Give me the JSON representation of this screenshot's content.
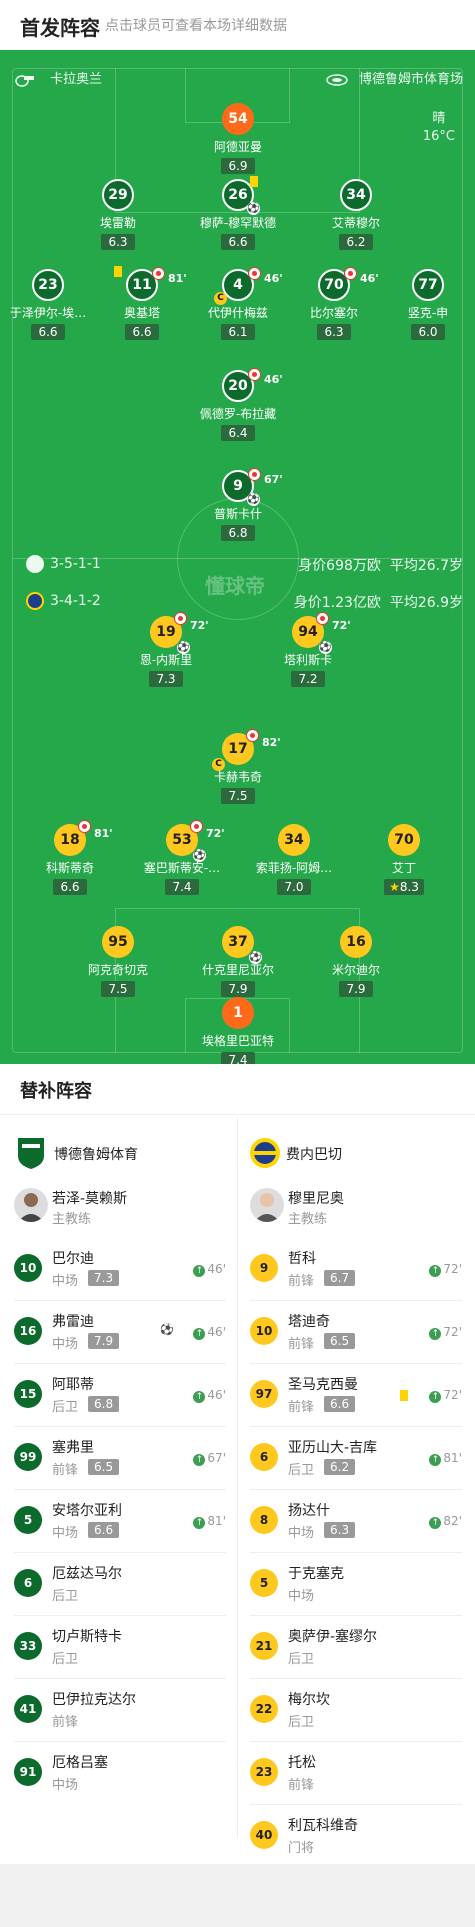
{
  "header": {
    "title": "首发阵容",
    "subtitle": "点击球员可查看本场详细数据"
  },
  "field": {
    "referee": "卡拉奥兰",
    "stadium": "博德鲁姆市体育场",
    "weather": "晴",
    "temp": "16°C",
    "brand": "懂球帝",
    "home": {
      "formation": "3-5-1-1",
      "value": "身价698万欧",
      "avg_age": "平均26.7岁"
    },
    "away": {
      "formation": "3-4-1-2",
      "value": "身价1.23亿欧",
      "avg_age": "平均26.9岁"
    },
    "players": [
      {
        "num": "54",
        "name": "阿德亚曼",
        "rating": "6.9",
        "side": "gk"
      },
      {
        "num": "29",
        "name": "埃雷勒",
        "rating": "6.3",
        "side": "h"
      },
      {
        "num": "26",
        "name": "穆萨-穆罕默德",
        "rating": "6.6",
        "side": "h"
      },
      {
        "num": "34",
        "name": "艾蒂穆尔",
        "rating": "6.2",
        "side": "h"
      },
      {
        "num": "23",
        "name": "于泽伊尔-埃…",
        "rating": "6.6",
        "side": "h"
      },
      {
        "num": "11",
        "name": "奥基塔",
        "rating": "6.6",
        "side": "h",
        "sub": "81'"
      },
      {
        "num": "4",
        "name": "代伊什梅兹",
        "rating": "6.1",
        "side": "h",
        "sub": "46'"
      },
      {
        "num": "70",
        "name": "比尔塞尔",
        "rating": "6.3",
        "side": "h",
        "sub": "46'"
      },
      {
        "num": "77",
        "name": "竖克-申",
        "rating": "6.0",
        "side": "h"
      },
      {
        "num": "20",
        "name": "佩德罗-布拉藏",
        "rating": "6.4",
        "side": "h",
        "sub": "46'"
      },
      {
        "num": "9",
        "name": "普斯卡什",
        "rating": "6.8",
        "side": "h",
        "sub": "67'"
      },
      {
        "num": "19",
        "name": "恩-内斯里",
        "rating": "7.3",
        "side": "a",
        "sub": "72'"
      },
      {
        "num": "94",
        "name": "塔利斯卡",
        "rating": "7.2",
        "side": "a",
        "sub": "72'"
      },
      {
        "num": "17",
        "name": "卡赫韦奇",
        "rating": "7.5",
        "side": "a",
        "sub": "82'"
      },
      {
        "num": "18",
        "name": "科斯蒂奇",
        "rating": "6.6",
        "side": "a",
        "sub": "81'"
      },
      {
        "num": "53",
        "name": "塞巴斯蒂安-…",
        "rating": "7.4",
        "side": "a",
        "sub": "72'"
      },
      {
        "num": "34",
        "name": "索菲扬-阿姆…",
        "rating": "7.0",
        "side": "a"
      },
      {
        "num": "70",
        "name": "艾丁",
        "rating": "8.3",
        "side": "a"
      },
      {
        "num": "95",
        "name": "阿克奇切克",
        "rating": "7.5",
        "side": "a"
      },
      {
        "num": "37",
        "name": "什克里尼亚尔",
        "rating": "7.9",
        "side": "a"
      },
      {
        "num": "16",
        "name": "米尔迪尔",
        "rating": "7.9",
        "side": "a"
      },
      {
        "num": "1",
        "name": "埃格里巴亚特",
        "rating": "7.4",
        "side": "gk"
      }
    ]
  },
  "subs": {
    "title": "替补阵容",
    "home": {
      "team": "博德鲁姆体育",
      "coach": "若泽-莫赖斯",
      "coach_role": "主教练",
      "list": [
        {
          "num": "10",
          "name": "巴尔迪",
          "pos": "中场",
          "rating": "7.3",
          "in": "46'"
        },
        {
          "num": "16",
          "name": "弗雷迪",
          "pos": "中场",
          "rating": "7.9",
          "in": "46'"
        },
        {
          "num": "15",
          "name": "阿耶蒂",
          "pos": "后卫",
          "rating": "6.8",
          "in": "46'"
        },
        {
          "num": "99",
          "name": "塞弗里",
          "pos": "前锋",
          "rating": "6.5",
          "in": "67'"
        },
        {
          "num": "5",
          "name": "安塔尔亚利",
          "pos": "中场",
          "rating": "6.6",
          "in": "81'"
        },
        {
          "num": "6",
          "name": "厄兹达马尔",
          "pos": "后卫"
        },
        {
          "num": "33",
          "name": "切卢斯特卡",
          "pos": "后卫"
        },
        {
          "num": "41",
          "name": "巴伊拉克达尔",
          "pos": "前锋"
        },
        {
          "num": "91",
          "name": "厄格吕塞",
          "pos": "中场"
        }
      ]
    },
    "away": {
      "team": "费内巴切",
      "coach": "穆里尼奥",
      "coach_role": "主教练",
      "list": [
        {
          "num": "9",
          "name": "哲科",
          "pos": "前锋",
          "rating": "6.7",
          "in": "72'"
        },
        {
          "num": "10",
          "name": "塔迪奇",
          "pos": "前锋",
          "rating": "6.5",
          "in": "72'"
        },
        {
          "num": "97",
          "name": "圣马克西曼",
          "pos": "前锋",
          "rating": "6.6",
          "in": "72'"
        },
        {
          "num": "6",
          "name": "亚历山大-吉库",
          "pos": "后卫",
          "rating": "6.2",
          "in": "81'"
        },
        {
          "num": "8",
          "name": "扬达什",
          "pos": "中场",
          "rating": "6.3",
          "in": "82'"
        },
        {
          "num": "5",
          "name": "于克塞克",
          "pos": "中场"
        },
        {
          "num": "21",
          "name": "奥萨伊-塞缪尔",
          "pos": "后卫"
        },
        {
          "num": "22",
          "name": "梅尔坎",
          "pos": "后卫"
        },
        {
          "num": "23",
          "name": "托松",
          "pos": "前锋"
        },
        {
          "num": "40",
          "name": "利瓦科维奇",
          "pos": "门将"
        }
      ]
    }
  }
}
